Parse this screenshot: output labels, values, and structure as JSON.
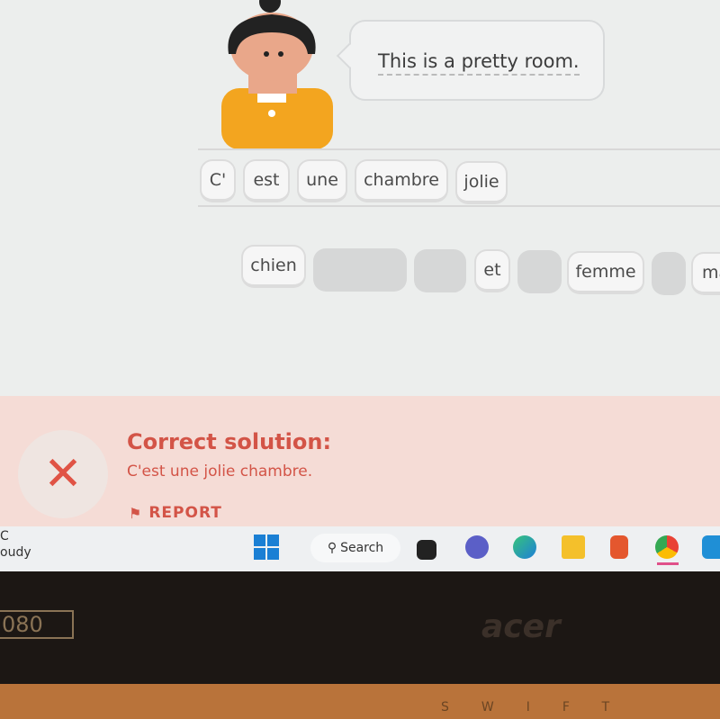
{
  "prompt": {
    "speech": "This is a pretty room."
  },
  "answer_tiles": [
    "C'",
    "est",
    "une",
    "chambre",
    "jolie"
  ],
  "word_bank": {
    "chien": "chien",
    "et": "et",
    "femme": "femme",
    "partial": "ma"
  },
  "feedback": {
    "title": "Correct solution:",
    "solution": "C'est une jolie chambre.",
    "report": "REPORT",
    "status_icon": "x-icon",
    "color": "#d35447"
  },
  "taskbar": {
    "weather_line1": "C",
    "weather_line2": "oudy",
    "search": "Search",
    "apps": [
      "windows-start",
      "task-view",
      "teams",
      "edge",
      "file-explorer",
      "office",
      "chrome",
      "app"
    ]
  },
  "hardware": {
    "bezel_label": "080",
    "logo": "acer",
    "keyboard_brand": "SWIFT"
  }
}
